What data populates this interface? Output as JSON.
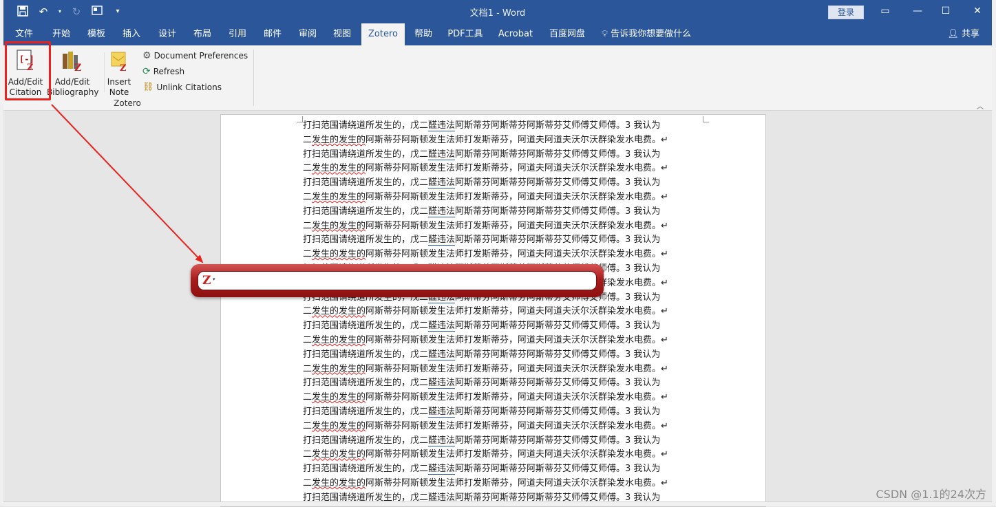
{
  "window": {
    "title": "文档1 - Word",
    "login": "登录"
  },
  "tabs": [
    "文件",
    "开始",
    "模板",
    "插入",
    "设计",
    "布局",
    "引用",
    "邮件",
    "审阅",
    "视图",
    "Zotero",
    "帮助",
    "PDF工具",
    "Acrobat",
    "百度网盘"
  ],
  "tell_me": "告诉我你想要做什么",
  "share": "共享",
  "ribbon": {
    "add_edit_citation": [
      "Add/Edit",
      "Citation"
    ],
    "add_edit_bibliography": [
      "Add/Edit",
      "Bibliography"
    ],
    "insert_note": [
      "Insert",
      "Note"
    ],
    "document_preferences": "Document Preferences",
    "refresh": "Refresh",
    "unlink_citations": "Unlink Citations",
    "group_label": "Zotero"
  },
  "document": {
    "line_a": [
      "打扫范围请绕道所发生的，戊二",
      "醛违法",
      "阿斯蒂芬阿斯蒂芬阿斯蒂芬艾师傅艾师傅。3 我认为"
    ],
    "line_b": [
      "二",
      "发生的发生的",
      "阿斯蒂芬阿斯顿发生法师打发斯蒂芬，阿道夫阿道夫沃尔沃群染发水电费。↵"
    ]
  },
  "zotero_bar": {
    "logo": "Z",
    "dropdown": "▾",
    "value": ""
  },
  "watermark": "CSDN @1.1的24次方",
  "colors": {
    "word_blue": "#2b579a",
    "highlight_red": "#e8231d",
    "zotero_red": "#a81d1d"
  }
}
